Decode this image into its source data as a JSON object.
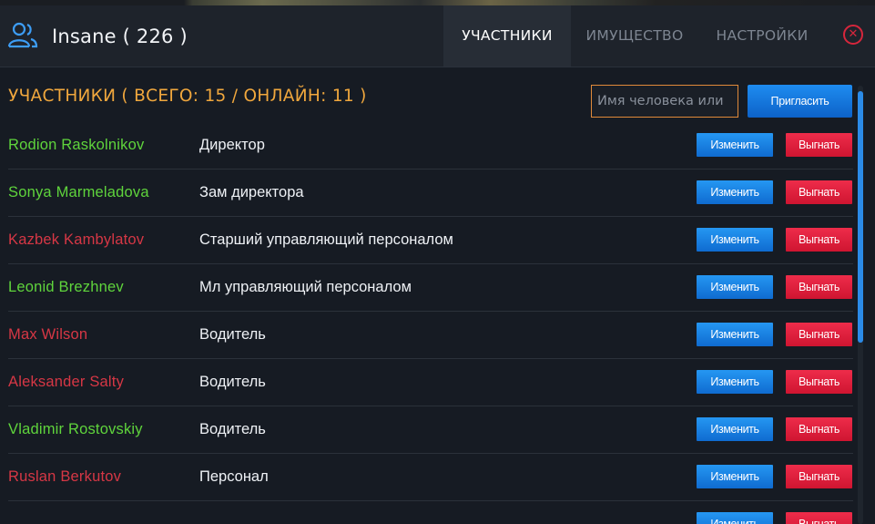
{
  "header": {
    "title": "Insane ( 226 )",
    "tabs": [
      {
        "label": "УЧАСТНИКИ",
        "active": true
      },
      {
        "label": "ИМУЩЕСТВО",
        "active": false
      },
      {
        "label": "НАСТРОЙКИ",
        "active": false
      }
    ],
    "close_icon": "close-icon",
    "brand_icon": "users-icon"
  },
  "members_section": {
    "title": "УЧАСТНИКИ ( ВСЕГО: 15 / ОНЛАЙН: 11 )",
    "search_placeholder": "Имя человека или",
    "invite_label": "Пригласить"
  },
  "members": [
    {
      "name": "Rodion Raskolnikov",
      "role": "Директор",
      "online": true
    },
    {
      "name": "Sonya Marmeladova",
      "role": "Зам директора",
      "online": true
    },
    {
      "name": "Kazbek Kambylatov",
      "role": "Старший управляющий персоналом",
      "online": false
    },
    {
      "name": "Leonid Brezhnev",
      "role": "Мл управляющий персоналом",
      "online": true
    },
    {
      "name": "Max Wilson",
      "role": "Водитель",
      "online": false
    },
    {
      "name": "Aleksander Salty",
      "role": "Водитель",
      "online": false
    },
    {
      "name": "Vladimir Rostovskiy",
      "role": "Водитель",
      "online": true
    },
    {
      "name": "Ruslan Berkutov",
      "role": "Персонал",
      "online": false
    },
    {
      "name": "",
      "role": "",
      "online": true
    }
  ],
  "row_actions": {
    "edit_label": "Изменить",
    "kick_label": "Выгнать"
  },
  "colors": {
    "accent_title": "#f0a73d",
    "online": "#5fd43c",
    "offline": "#d63745",
    "edit_button": "#1a82e6",
    "kick_button": "#e3213f",
    "scroll_thumb": "#2b8be8"
  }
}
